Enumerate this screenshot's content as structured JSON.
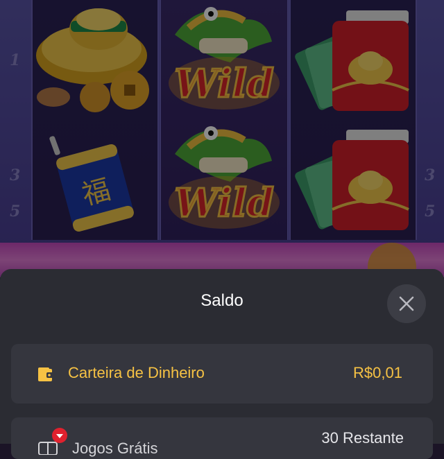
{
  "game": {
    "paylines_left": [
      "1",
      "3",
      "5"
    ],
    "paylines_right": [
      "3",
      "5"
    ],
    "reels": [
      {
        "symbols": [
          "gold-ingot-icon",
          "firecracker-icon"
        ]
      },
      {
        "symbols": [
          "dragon-wild-icon",
          "dragon-wild-icon"
        ],
        "wild_text": "Wild"
      },
      {
        "symbols": [
          "red-envelope-icon",
          "red-envelope-icon"
        ]
      }
    ]
  },
  "sheet": {
    "title": "Saldo",
    "close_icon": "close-icon",
    "wallet": {
      "label": "Carteira de Dinheiro",
      "value": "R$0,01",
      "icon": "wallet-icon"
    },
    "free_games": {
      "label": "Jogos Grátis",
      "remaining": "30 Restante",
      "icon": "gift-icon"
    }
  },
  "colors": {
    "accent": "#f6c244",
    "sheet_bg": "#2b2c33",
    "row_bg": "#35363e"
  }
}
